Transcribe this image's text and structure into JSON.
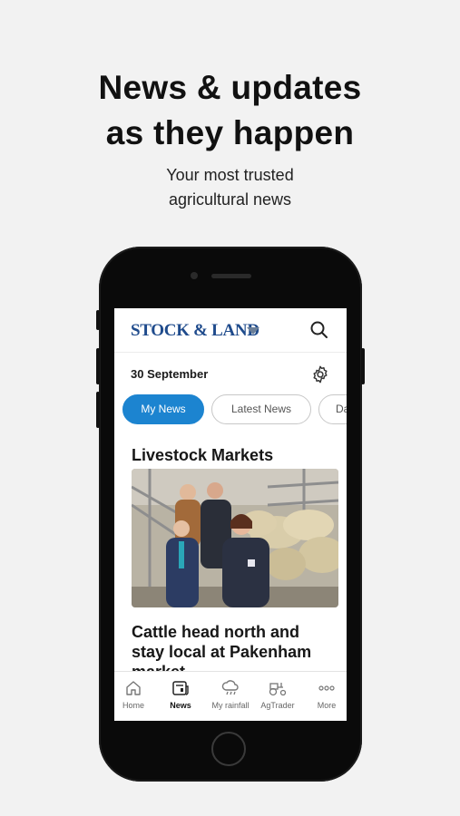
{
  "promo": {
    "title_line1": "News & updates",
    "title_line2": "as they happen",
    "subtitle_line1": "Your most trusted",
    "subtitle_line2": "agricultural news"
  },
  "app": {
    "logo": "Stock & Land",
    "logo_display": "STOCK & LAND",
    "date": "30 September",
    "tabs": [
      {
        "label": "My News",
        "active": true
      },
      {
        "label": "Latest News",
        "active": false
      },
      {
        "label": "Da",
        "active": false
      }
    ],
    "section_title": "Livestock Markets",
    "headline": "Cattle head north and stay local at Pakenham market",
    "bottom_nav": [
      {
        "label": "Home",
        "icon": "home-icon"
      },
      {
        "label": "News",
        "icon": "news-icon",
        "active": true
      },
      {
        "label": "My rainfall",
        "icon": "rain-cloud-icon"
      },
      {
        "label": "AgTrader",
        "icon": "tractor-icon"
      },
      {
        "label": "More",
        "icon": "more-dots-icon"
      }
    ],
    "colors": {
      "brand_blue": "#1f4b8c",
      "active_tab": "#1c84d0"
    }
  }
}
